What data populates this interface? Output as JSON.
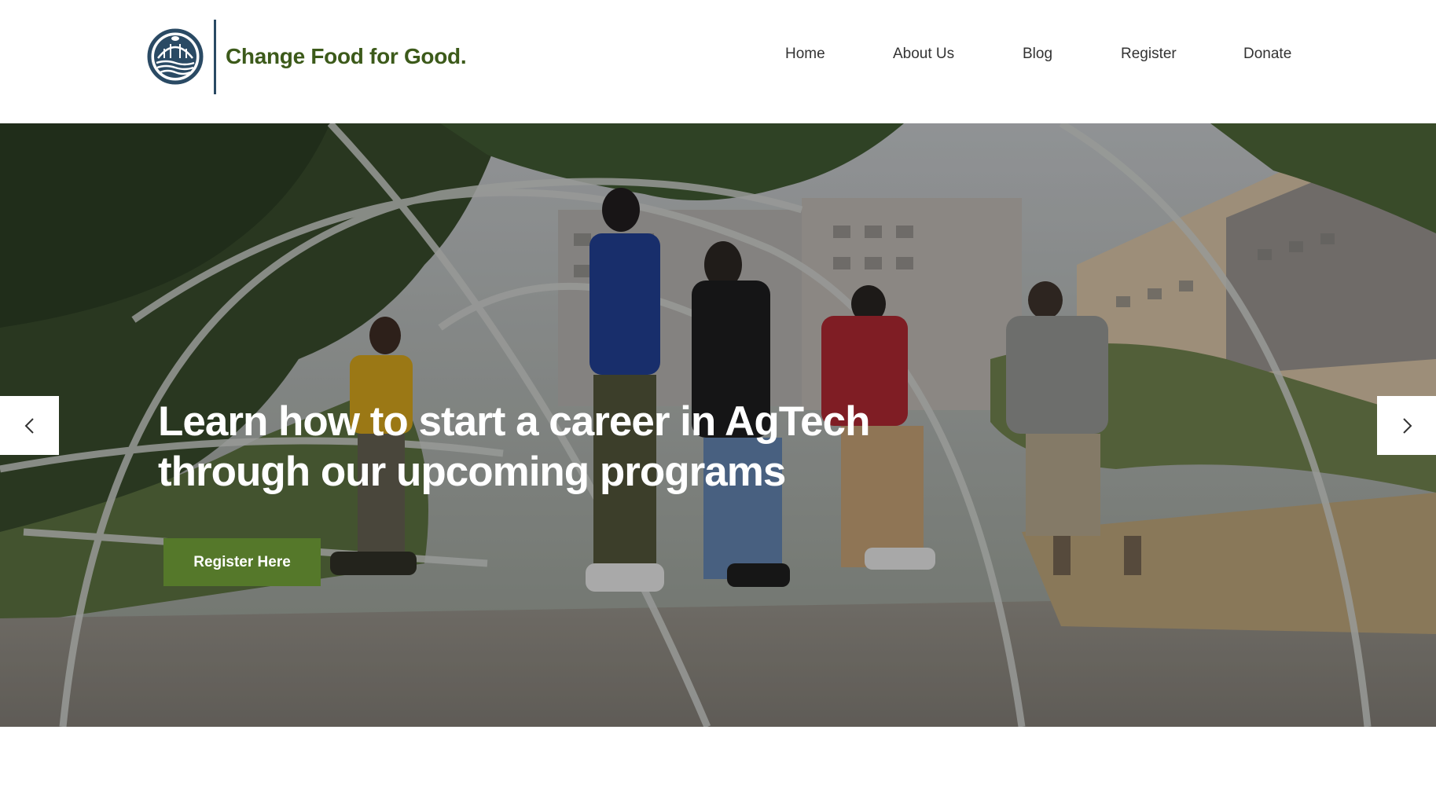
{
  "brand": {
    "name": "Change Food for Good.",
    "logo_icon": "greenhouse-logo-icon",
    "primary_color": "#2a4a64",
    "text_color": "#3c5a1a"
  },
  "nav": {
    "items": [
      {
        "label": "Home"
      },
      {
        "label": "About Us"
      },
      {
        "label": "Blog"
      },
      {
        "label": "Register"
      },
      {
        "label": "Donate"
      }
    ]
  },
  "hero": {
    "headline_line1": "Learn how to start a career in AgTech",
    "headline_line2": "through our upcoming programs",
    "cta_label": "Register Here",
    "cta_color": "#55782a",
    "prev_icon": "chevron-left-icon",
    "next_icon": "chevron-right-icon"
  }
}
